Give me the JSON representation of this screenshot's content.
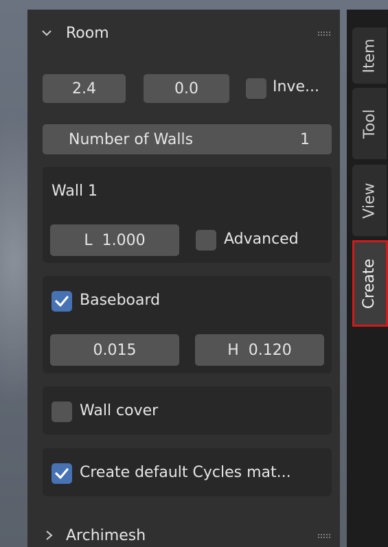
{
  "tabs": [
    {
      "label": "Item"
    },
    {
      "label": "Tool"
    },
    {
      "label": "View"
    },
    {
      "label": "Create"
    }
  ],
  "room": {
    "title": "Room",
    "height_value": "2.4",
    "thickness_value": "0.0",
    "invert_label": "Inve...",
    "walls_label": "Number of Walls",
    "walls_value": "1"
  },
  "wall1": {
    "title": "Wall 1",
    "length_value": "L  1.000",
    "advanced_label": "Advanced"
  },
  "baseboard": {
    "label": "Baseboard",
    "checked": true,
    "depth_value": "0.015",
    "height_value": "H  0.120"
  },
  "wall_cover": {
    "label": "Wall cover",
    "checked": false
  },
  "materials": {
    "label": "Create default Cycles mat...",
    "checked": true
  },
  "archimesh": {
    "title": "Archimesh"
  },
  "colors": {
    "panel": "#303030",
    "field": "#545454",
    "checkbox_on": "#4772b3",
    "highlight": "#d11b1b"
  }
}
